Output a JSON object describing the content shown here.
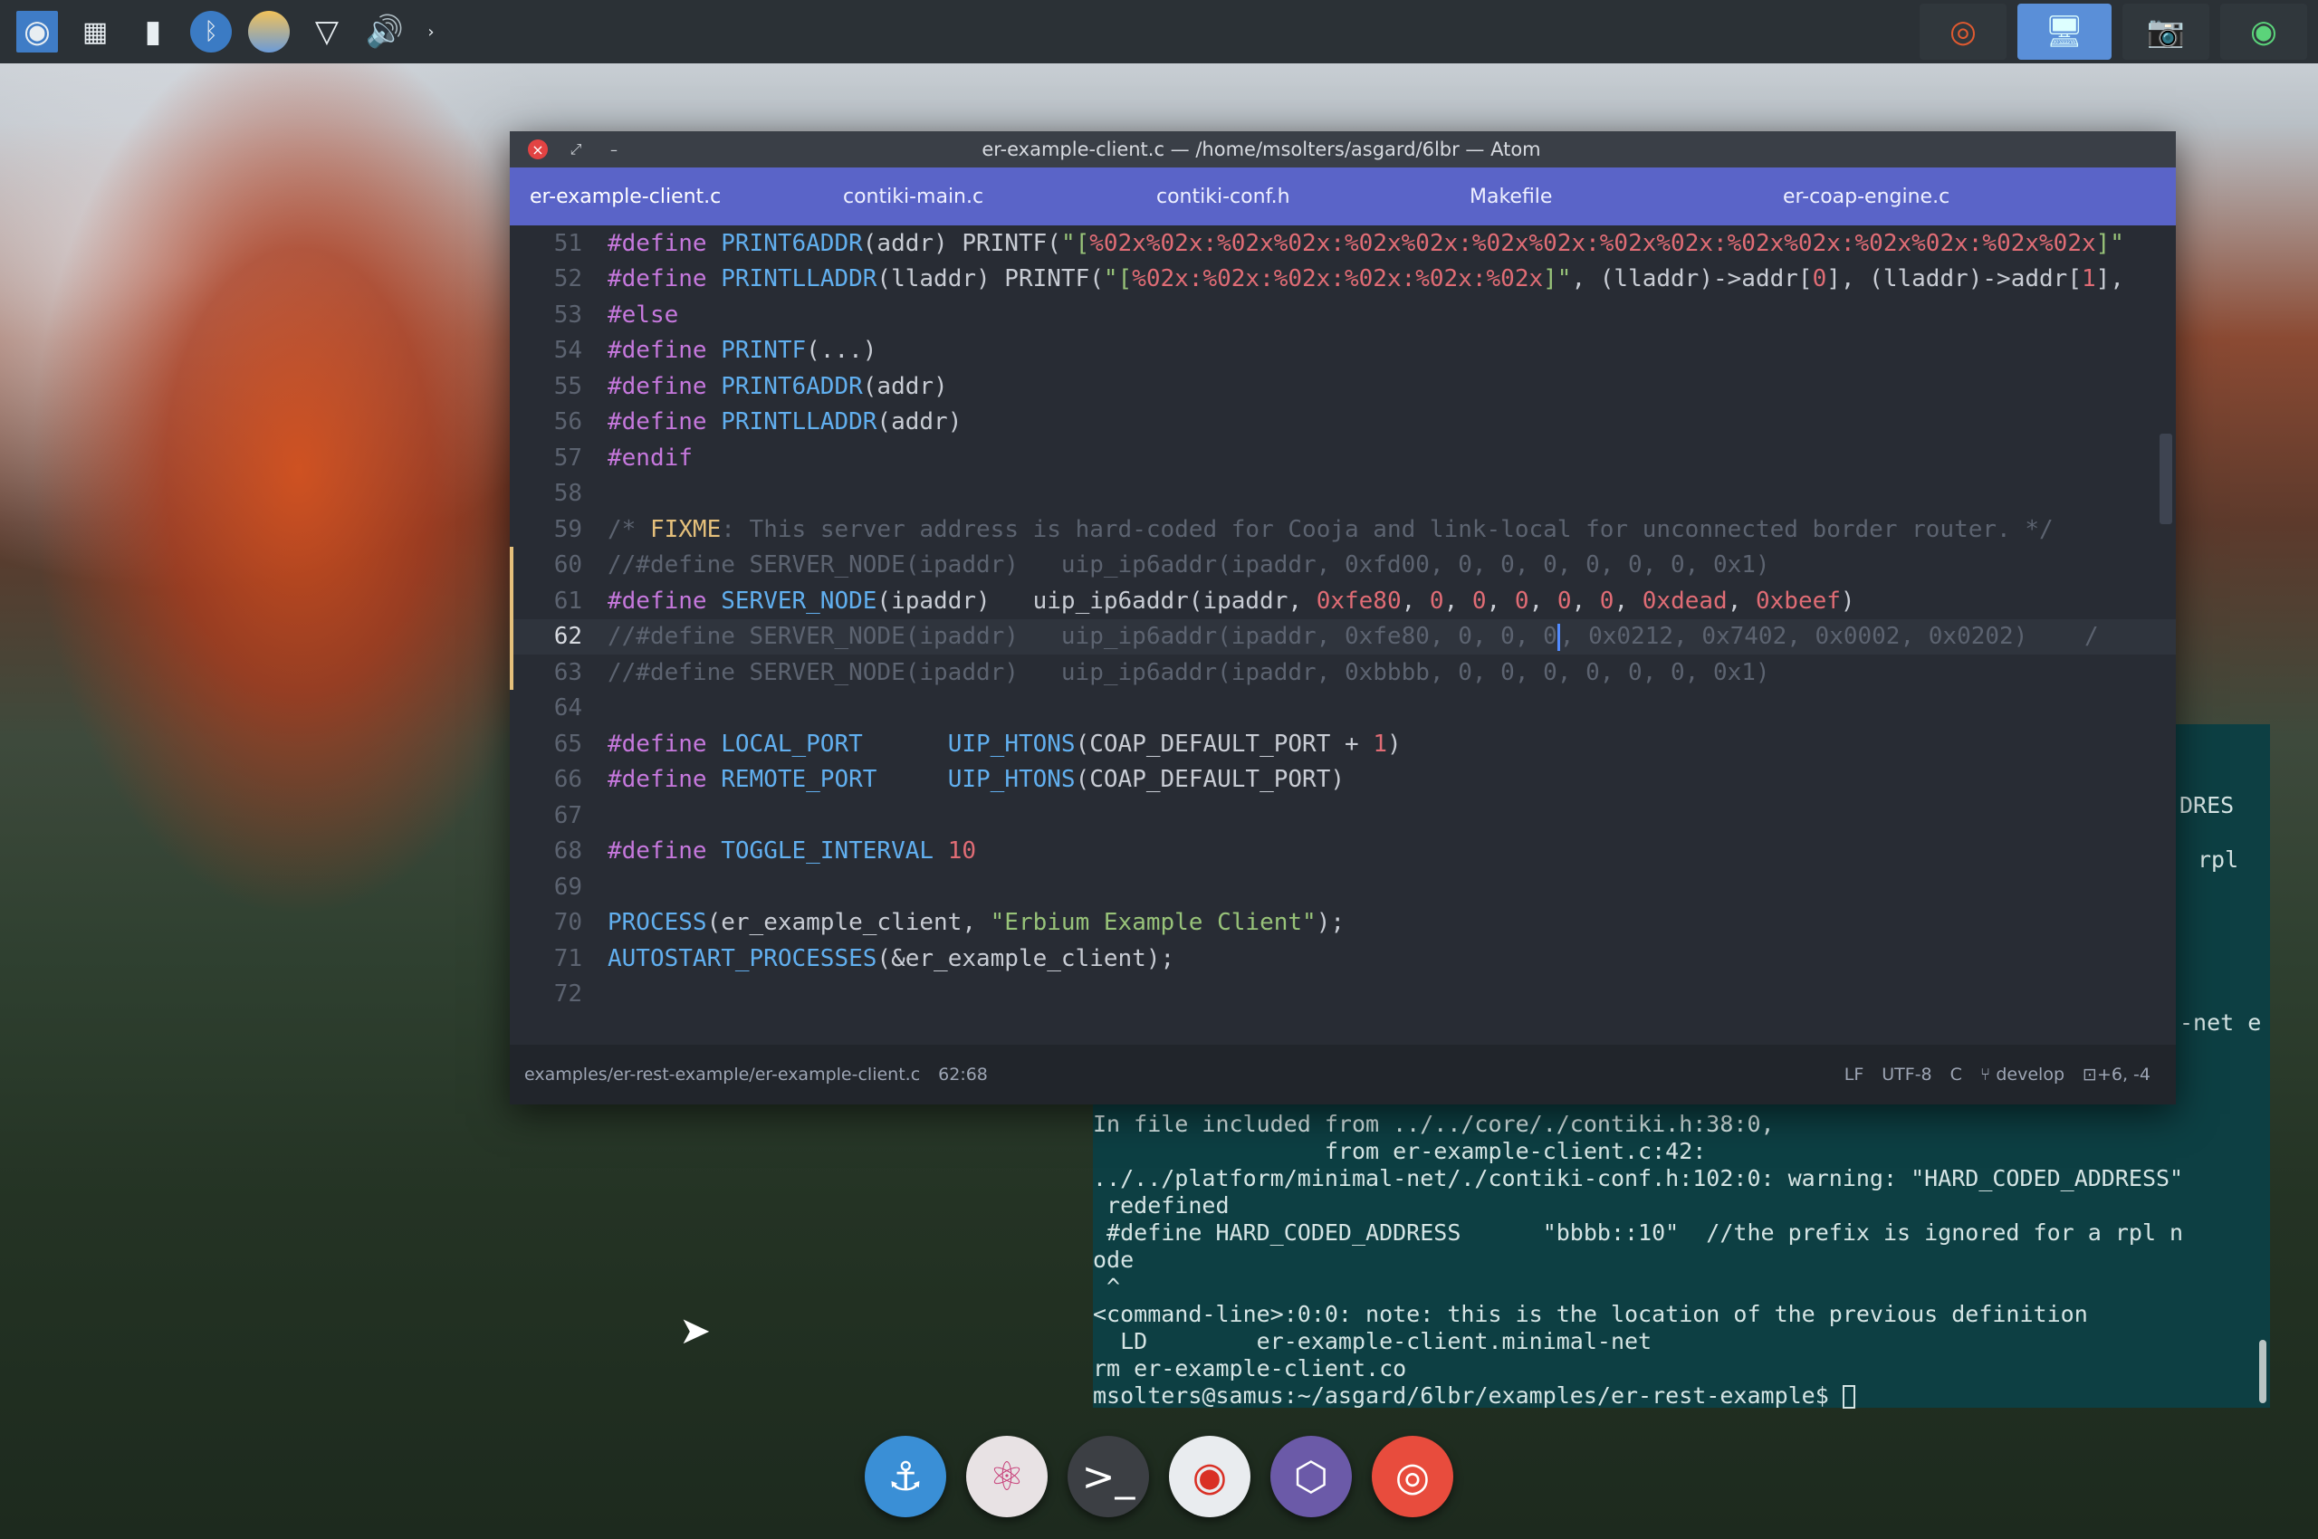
{
  "top_panel": {
    "launchers": [
      {
        "icon": "app-menu-icon"
      },
      {
        "icon": "workspace-switcher-icon"
      },
      {
        "icon": "clipboard-icon"
      },
      {
        "icon": "bluetooth-icon"
      },
      {
        "icon": "night-light-icon"
      },
      {
        "icon": "wifi-icon"
      },
      {
        "icon": "volume-icon"
      },
      {
        "icon": "chevron-right-icon"
      }
    ],
    "windows": [
      {
        "icon": "record-icon"
      },
      {
        "icon": "network-window-icon"
      },
      {
        "icon": "screenshot-icon"
      },
      {
        "icon": "globe-icon"
      }
    ]
  },
  "atom": {
    "title": "er-example-client.c — /home/msolters/asgard/6lbr — Atom",
    "tabs": [
      "er-example-client.c",
      "contiki-main.c",
      "contiki-conf.h",
      "Makefile",
      "er-coap-engine.c"
    ],
    "lines": [
      {
        "n": "51",
        "html": "<span class='kw'>#define</span> <span class='mac'>PRINT6ADDR</span>(addr) PRINTF(<span class='str'>\"[</span><span class='num'>%02x%02x:%02x%02x:%02x%02x:%02x%02x:%02x%02x:%02x%02x:%02x%02x:%02x%02x</span><span class='str'>]\"</span>"
      },
      {
        "n": "52",
        "html": "<span class='kw'>#define</span> <span class='mac'>PRINTLLADDR</span>(lladdr) PRINTF(<span class='str'>\"[</span><span class='num'>%02x:%02x:%02x:%02x:%02x:%02x</span><span class='str'>]\"</span>, (lladdr)->addr[<span class='num'>0</span>], (lladdr)->addr[<span class='num'>1</span>],"
      },
      {
        "n": "53",
        "html": "<span class='kw'>#else</span>"
      },
      {
        "n": "54",
        "html": "<span class='kw'>#define</span> <span class='mac'>PRINTF</span>(...)"
      },
      {
        "n": "55",
        "html": "<span class='kw'>#define</span> <span class='mac'>PRINT6ADDR</span>(addr)"
      },
      {
        "n": "56",
        "html": "<span class='kw'>#define</span> <span class='mac'>PRINTLLADDR</span>(addr)"
      },
      {
        "n": "57",
        "html": "<span class='kw'>#endif</span>"
      },
      {
        "n": "58",
        "html": ""
      },
      {
        "n": "59",
        "html": "<span class='cmt'>/* </span><span class='fix'>FIXME</span><span class='cmt'>: This server address is hard-coded for Cooja and link-local for unconnected border router. */</span>"
      },
      {
        "n": "60",
        "html": "<span class='cmt'>//#define SERVER_NODE(ipaddr)   uip_ip6addr(ipaddr, 0xfd00, 0, 0, 0, 0, 0, 0, 0x1)</span>"
      },
      {
        "n": "61",
        "html": "<span class='kw'>#define</span> <span class='mac'>SERVER_NODE</span>(ipaddr)   uip_ip6addr(ipaddr, <span class='num'>0xfe80</span>, <span class='num'>0</span>, <span class='num'>0</span>, <span class='num'>0</span>, <span class='num'>0</span>, <span class='num'>0</span>, <span class='num'>0xdead</span>, <span class='num'>0xbeef</span>)"
      },
      {
        "n": "62",
        "html": "<span class='cmt'>//#define SERVER_NODE(ipaddr)   uip_ip6addr(ipaddr, 0xfe80, 0, 0, 0</span><span class='editor-cursor'></span><span class='cmt'>, 0x0212, 0x7402, 0x0002, 0x0202)    /</span>"
      },
      {
        "n": "63",
        "html": "<span class='cmt'>//#define SERVER_NODE(ipaddr)   uip_ip6addr(ipaddr, 0xbbbb, 0, 0, 0, 0, 0, 0, 0x1)</span>"
      },
      {
        "n": "64",
        "html": ""
      },
      {
        "n": "65",
        "html": "<span class='kw'>#define</span> <span class='mac'>LOCAL_PORT</span>      <span class='mac'>UIP_HTONS</span>(COAP_DEFAULT_PORT + <span class='num'>1</span>)"
      },
      {
        "n": "66",
        "html": "<span class='kw'>#define</span> <span class='mac'>REMOTE_PORT</span>     <span class='mac'>UIP_HTONS</span>(COAP_DEFAULT_PORT)"
      },
      {
        "n": "67",
        "html": ""
      },
      {
        "n": "68",
        "html": "<span class='kw'>#define</span> <span class='mac'>TOGGLE_INTERVAL</span> <span class='num'>10</span>"
      },
      {
        "n": "69",
        "html": ""
      },
      {
        "n": "70",
        "html": "<span class='mac'>PROCESS</span>(er_example_client, <span class='str'>\"Erbium Example Client\"</span>);"
      },
      {
        "n": "71",
        "html": "<span class='mac'>AUTOSTART_PROCESSES</span>(&amp;er_example_client);"
      },
      {
        "n": "72",
        "html": ""
      }
    ],
    "status": {
      "path": "examples/er-rest-example/er-example-client.c",
      "position": "62:68",
      "line_ending": "LF",
      "encoding": "UTF-8",
      "grammar": "C",
      "branch": "develop",
      "diff": "+6, -4"
    }
  },
  "terminal": {
    "side_lines": [
      "DRES",
      "rpl",
      "-net e"
    ],
    "lines": [
      "In file included from ../../core/./contiki.h:38:0,",
      "                 from er-example-client.c:42:",
      "../../platform/minimal-net/./contiki-conf.h:102:0: warning: \"HARD_CODED_ADDRESS\"",
      " redefined",
      " #define HARD_CODED_ADDRESS      \"bbbb::10\"  //the prefix is ignored for a rpl n",
      "ode",
      " ^",
      "<command-line>:0:0: note: this is the location of the previous definition",
      "  LD        er-example-client.minimal-net",
      "rm er-example-client.co",
      "msolters@samus:~/asgard/6lbr/examples/er-rest-example$ "
    ]
  },
  "dock": [
    {
      "icon": "anchor-icon",
      "color": "#3a8fd6"
    },
    {
      "icon": "atom-icon",
      "color": "#e8e2e4"
    },
    {
      "icon": "terminal-icon",
      "color": "#3c3f44"
    },
    {
      "icon": "chrome-icon",
      "color": "#e9ecef"
    },
    {
      "icon": "files-icon",
      "color": "#6b5aa8"
    },
    {
      "icon": "screenshot-tool-icon",
      "color": "#e84c3d"
    }
  ]
}
